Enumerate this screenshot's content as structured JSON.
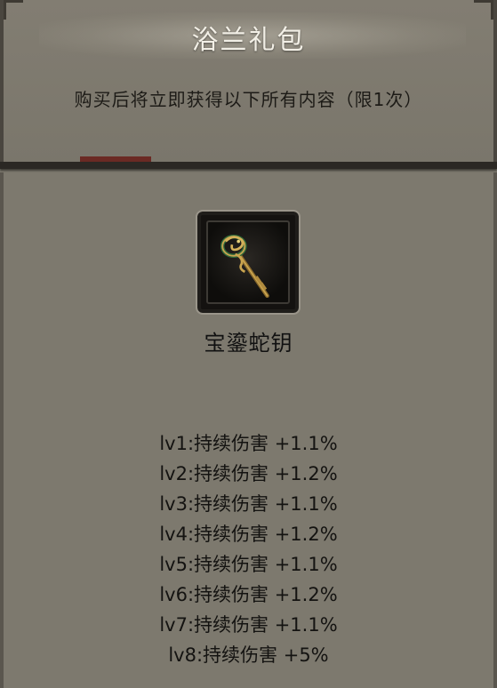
{
  "header": {
    "title": "浴兰礼包",
    "subtitle": "购买后将立即获得以下所有内容（限1次）"
  },
  "item": {
    "icon": "serpent-key-icon",
    "name": "宝鎏蛇钥"
  },
  "stats": [
    "lv1:持续伤害 +1.1%",
    "lv2:持续伤害 +1.2%",
    "lv3:持续伤害 +1.1%",
    "lv4:持续伤害 +1.2%",
    "lv5:持续伤害 +1.1%",
    "lv6:持续伤害 +1.2%",
    "lv7:持续伤害 +1.1%",
    "lv8:持续伤害 +5%"
  ],
  "colors": {
    "background": "#7c786d",
    "title": "#f2efe6",
    "text": "#141311",
    "frame": "#2b2824"
  }
}
